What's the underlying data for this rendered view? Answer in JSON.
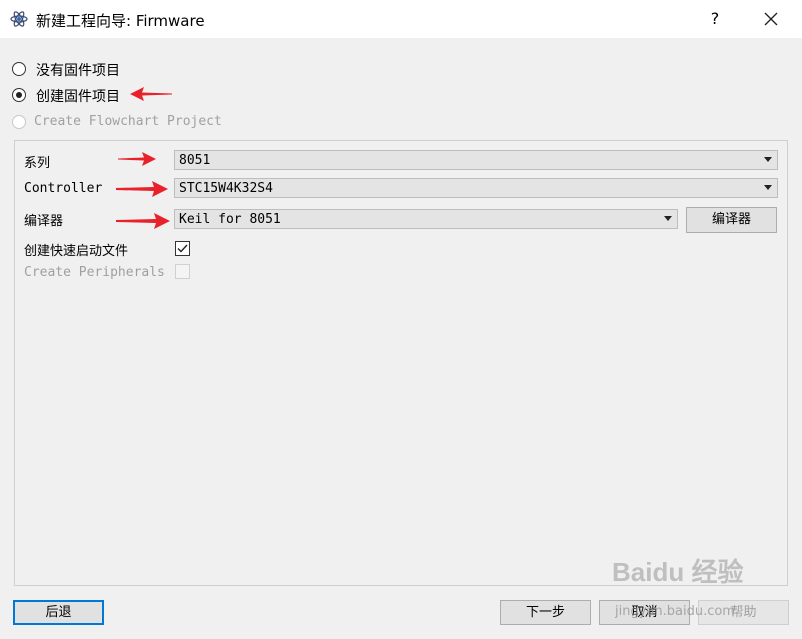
{
  "window": {
    "title": "新建工程向导: Firmware",
    "help_label": "?",
    "close_icon": "close-icon",
    "app_icon": "atom-icon"
  },
  "project_type": {
    "options": [
      {
        "label": "没有固件项目",
        "selected": false,
        "enabled": true
      },
      {
        "label": "创建固件项目",
        "selected": true,
        "enabled": true
      },
      {
        "label": "Create Flowchart Project",
        "selected": false,
        "enabled": false
      }
    ]
  },
  "settings": {
    "series_label": "系列",
    "series_value": "8051",
    "controller_label": "Controller",
    "controller_value": "STC15W4K32S4",
    "compiler_label": "编译器",
    "compiler_value": "Keil for 8051",
    "compiler_button": "编译器",
    "startup_label": "创建快速启动文件",
    "startup_checked": true,
    "peripherals_label": "Create Peripherals",
    "peripherals_checked": false
  },
  "footer": {
    "back": "后退",
    "next": "下一步",
    "cancel": "取消",
    "help": "帮助"
  },
  "watermark": {
    "brand": "Baidu 经验",
    "url": "jingyan.baidu.com"
  },
  "colors": {
    "annotation_arrow": "#e8212b",
    "focus_border": "#0078d7"
  }
}
